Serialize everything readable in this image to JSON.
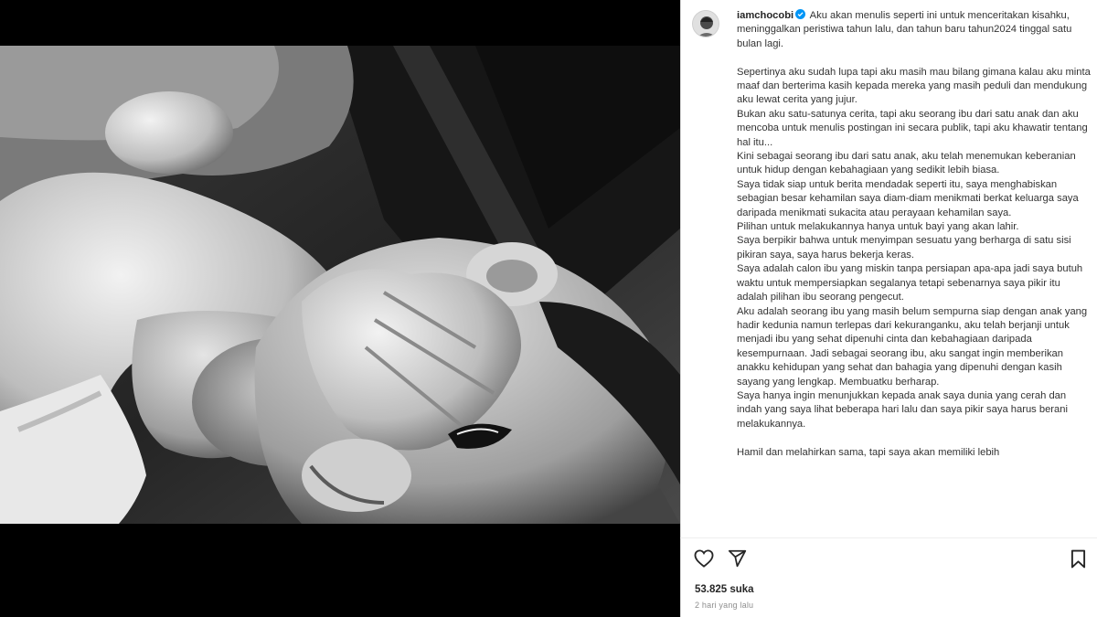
{
  "post": {
    "username": "iamchocobi",
    "verified": true,
    "caption_lines": [
      "Aku akan menulis seperti ini untuk menceritakan kisahku, meninggalkan peristiwa tahun lalu, dan tahun baru tahun2024 tinggal satu bulan lagi.",
      "",
      "Sepertinya aku sudah lupa tapi aku masih mau bilang gimana kalau aku minta maaf dan berterima kasih kepada mereka yang masih peduli dan mendukung aku lewat cerita yang jujur.",
      "Bukan aku satu-satunya cerita, tapi aku seorang ibu dari satu anak dan aku mencoba untuk menulis postingan ini secara publik, tapi aku khawatir tentang hal itu...",
      "Kini sebagai seorang ibu dari satu anak, aku telah menemukan keberanian untuk hidup dengan kebahagiaan yang sedikit lebih biasa.",
      "Saya tidak siap untuk berita mendadak seperti itu, saya menghabiskan sebagian besar kehamilan saya diam-diam menikmati berkat keluarga saya daripada menikmati sukacita atau perayaan kehamilan saya.",
      "Pilihan untuk melakukannya hanya untuk bayi yang akan lahir.",
      "Saya berpikir bahwa untuk menyimpan sesuatu yang berharga di satu sisi pikiran saya, saya harus bekerja keras.",
      "Saya adalah calon ibu yang miskin tanpa persiapan apa-apa jadi saya butuh waktu untuk mempersiapkan segalanya tetapi sebenarnya saya pikir itu adalah pilihan ibu seorang pengecut.",
      "Aku adalah seorang ibu yang masih belum sempurna siap dengan anak yang hadir kedunia namun terlepas dari kekuranganku, aku telah berjanji untuk menjadi ibu yang sehat dipenuhi cinta dan kebahagiaan daripada kesempurnaan. Jadi sebagai seorang ibu, aku sangat ingin memberikan anakku kehidupan yang sehat dan bahagia yang dipenuhi dengan kasih sayang yang lengkap. Membuatku berharap.",
      "Saya hanya ingin menunjukkan kepada anak saya dunia yang cerah dan indah yang saya lihat beberapa hari lalu dan saya pikir saya harus berani melakukannya.",
      "",
      "Hamil dan melahirkan sama, tapi saya akan memiliki lebih"
    ],
    "likes_text": "53.825 suka",
    "timestamp": "2 hari yang lalu"
  },
  "icons": {
    "verified": "verified-badge-icon",
    "like": "heart-icon",
    "share": "paper-plane-icon",
    "save": "bookmark-icon"
  },
  "colors": {
    "verified": "#0095f6",
    "text": "#262626",
    "muted": "#8e8e8e",
    "media_bg": "#000000"
  }
}
